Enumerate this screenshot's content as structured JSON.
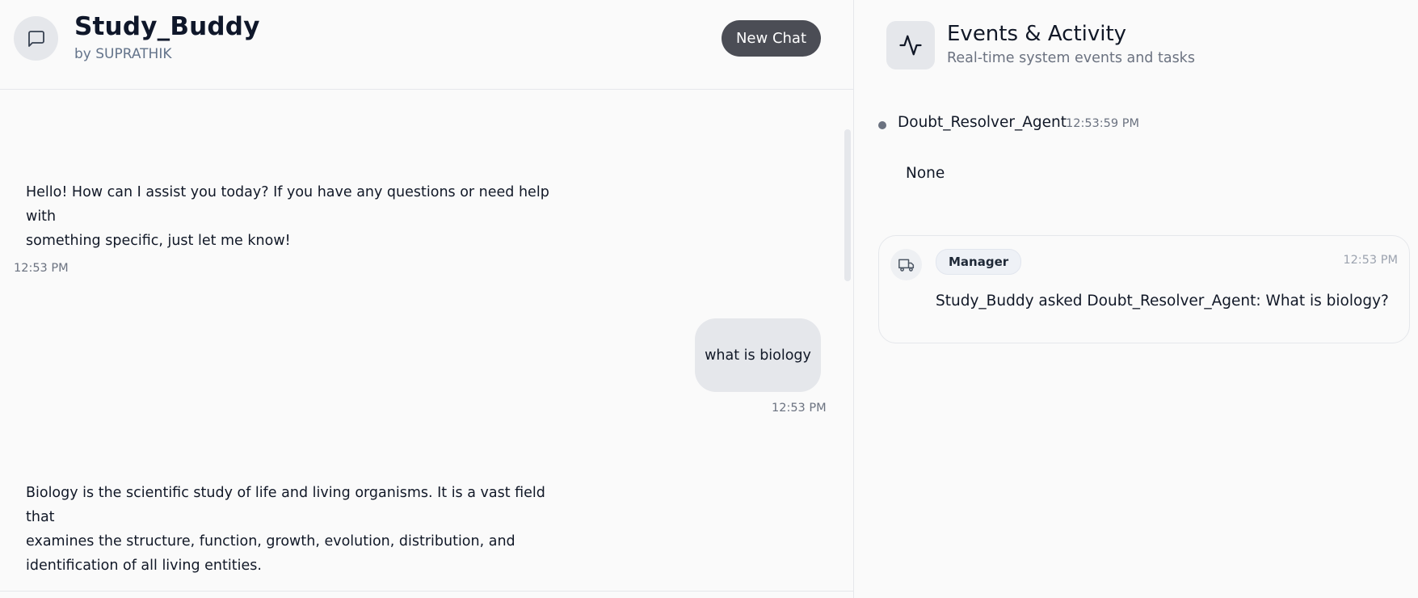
{
  "chat": {
    "title": "Study_Buddy",
    "subtitle": "by SUPRATHIK",
    "new_chat_label": "New Chat",
    "header_icon": "message-square-icon",
    "messages": [
      {
        "role": "assistant",
        "lines": [
          "Hello! How can I assist you today? If you have any questions or need help with",
          "something specific, just let me know!"
        ],
        "time": "12:53 PM"
      },
      {
        "role": "user",
        "text": "what is biology",
        "time": "12:53 PM"
      },
      {
        "role": "assistant",
        "lines": [
          "Biology is the scientific study of life and living organisms. It is a vast field that",
          "examines the structure, function, growth, evolution, distribution, and",
          "identification of all living entities."
        ]
      }
    ]
  },
  "events": {
    "title": "Events & Activity",
    "subtitle": "Real-time system events and tasks",
    "header_icon": "activity-icon",
    "items": [
      {
        "agent": "Doubt_Resolver_Agent",
        "time": "12:53:59 PM",
        "body": "None"
      }
    ],
    "cards": [
      {
        "icon": "truck-icon",
        "badge": "Manager",
        "time": "12:53 PM",
        "text": "Study_Buddy asked Doubt_Resolver_Agent: What is biology?"
      }
    ]
  },
  "colors": {
    "background": "#fafafa",
    "button": "#4b4d55",
    "bubble": "#e5e7eb",
    "muted_text": "#6b7280"
  }
}
